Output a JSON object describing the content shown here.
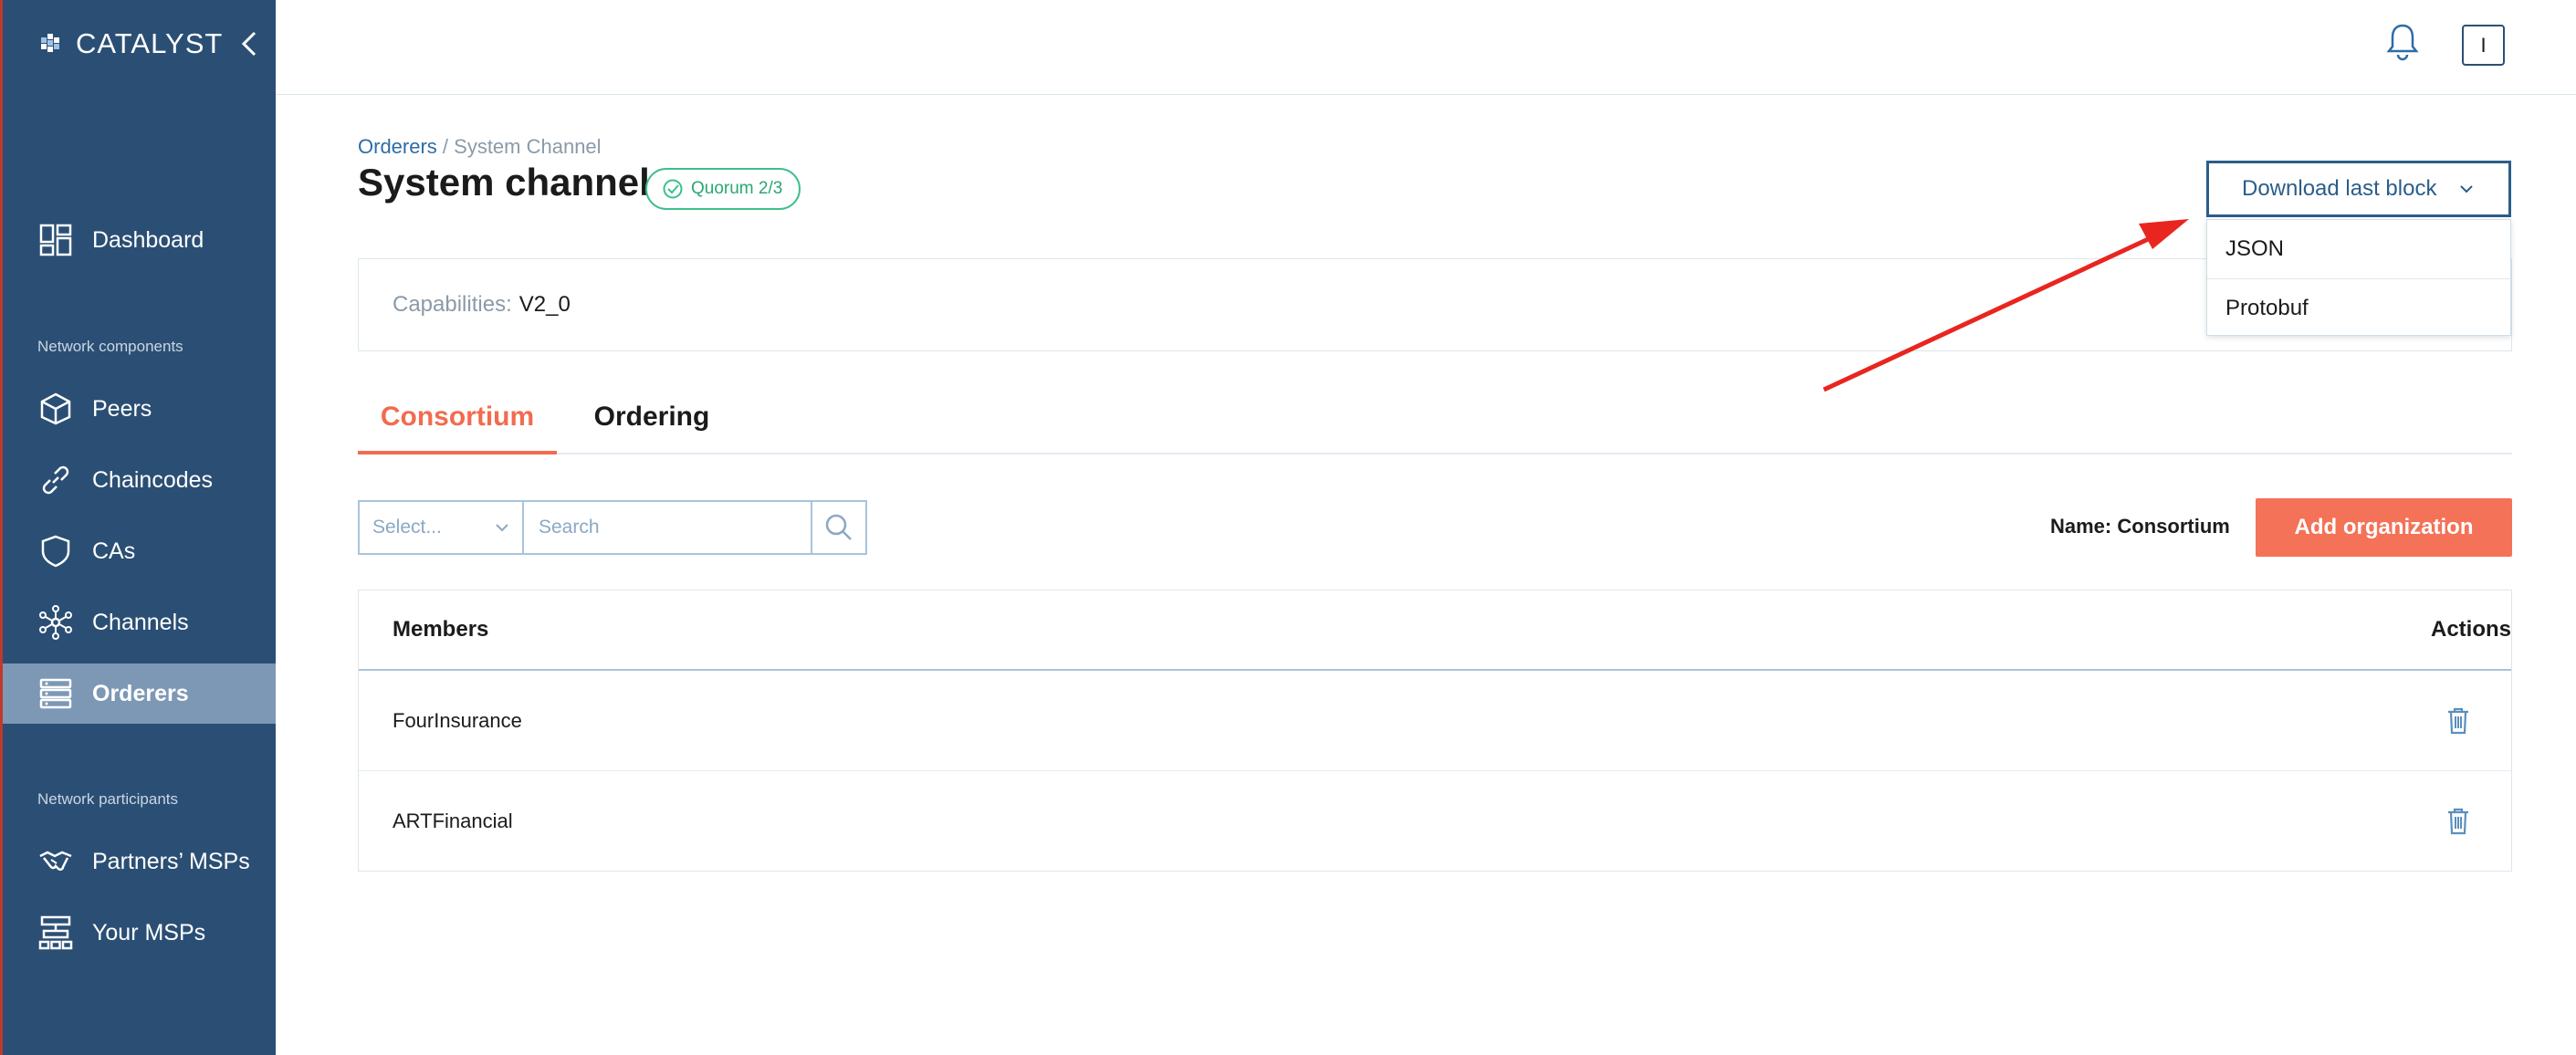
{
  "app": {
    "logo_text": "CATALYST"
  },
  "sidebar": {
    "items": [
      {
        "label": "Dashboard",
        "icon": "dashboard-icon"
      },
      {
        "label": "Peers",
        "icon": "cube-icon"
      },
      {
        "label": "Chaincodes",
        "icon": "link-icon"
      },
      {
        "label": "CAs",
        "icon": "shield-icon"
      },
      {
        "label": "Channels",
        "icon": "network-icon"
      },
      {
        "label": "Orderers",
        "icon": "server-icon",
        "active": true
      },
      {
        "label": "Partners’ MSPs",
        "icon": "handshake-icon"
      },
      {
        "label": "Your MSPs",
        "icon": "hierarchy-icon"
      }
    ],
    "sections": {
      "network_components": "Network components",
      "network_participants": "Network participants"
    }
  },
  "header": {
    "user_initial": "I"
  },
  "breadcrumb": {
    "parent": "Orderers",
    "separator": " / ",
    "current": "System Channel"
  },
  "page": {
    "title": "System channel",
    "quorum_badge": "Quorum 2/3"
  },
  "download": {
    "button_label": "Download last block",
    "options": [
      "JSON",
      "Protobuf"
    ]
  },
  "capabilities": {
    "label": "Capabilities:",
    "value": "V2_0"
  },
  "tabs": [
    {
      "label": "Consortium",
      "active": true
    },
    {
      "label": "Ordering",
      "active": false
    }
  ],
  "filter": {
    "select_placeholder": "Select...",
    "search_placeholder": "Search"
  },
  "consortium": {
    "name_label": "Name:",
    "name_value": "Consortium",
    "add_button": "Add organization"
  },
  "table": {
    "columns": [
      "Members",
      "Actions"
    ],
    "rows": [
      {
        "member": "FourInsurance"
      },
      {
        "member": "ARTFinancial"
      }
    ]
  },
  "colors": {
    "sidebar_bg": "#2b4f74",
    "active_item_bg": "#7d98b5",
    "accent_orange": "#f26b4f",
    "quorum_green": "#3cc08a",
    "annotation_arrow": "#e8261f"
  }
}
